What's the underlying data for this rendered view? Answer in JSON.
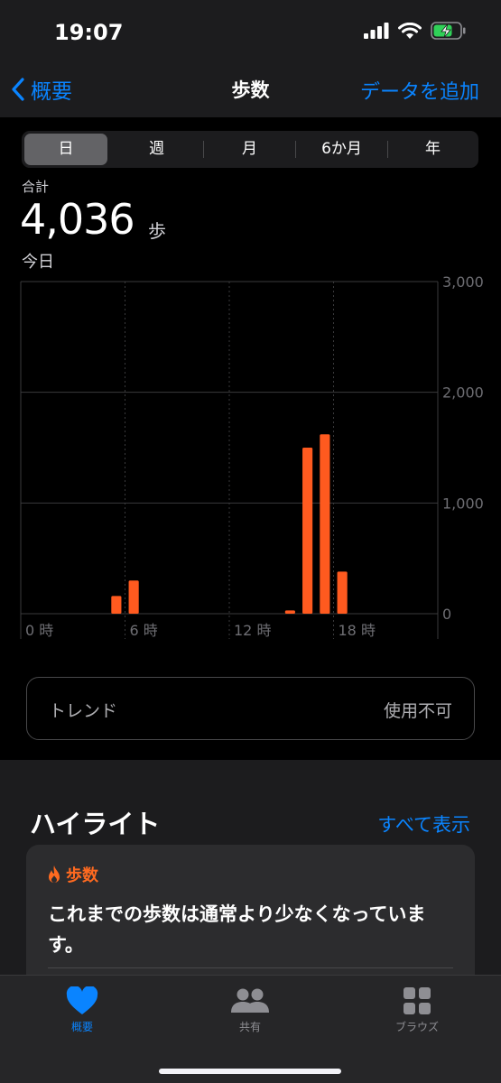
{
  "status_bar": {
    "time": "19:07"
  },
  "nav": {
    "back_label": "概要",
    "title": "歩数",
    "add_label": "データを追加"
  },
  "segments": [
    "日",
    "週",
    "月",
    "6か月",
    "年"
  ],
  "summary": {
    "label": "合計",
    "value": "4,036",
    "unit": "歩",
    "date": "今日"
  },
  "chart_data": {
    "type": "bar",
    "x_ticks": [
      "0 時",
      "6 時",
      "12 時",
      "18 時"
    ],
    "y_ticks": [
      "0",
      "1,000",
      "2,000",
      "3,000"
    ],
    "ylim": [
      0,
      3000
    ],
    "xlim": [
      0,
      24
    ],
    "grid": true,
    "color": "#ff5a1f",
    "values": [
      {
        "hour": 5,
        "value": 160
      },
      {
        "hour": 6,
        "value": 300
      },
      {
        "hour": 15,
        "value": 30
      },
      {
        "hour": 16,
        "value": 1500
      },
      {
        "hour": 17,
        "value": 1620
      },
      {
        "hour": 18,
        "value": 380
      }
    ]
  },
  "trend": {
    "label": "トレンド",
    "value": "使用不可"
  },
  "highlights": {
    "title": "ハイライト",
    "show_all": "すべて表示",
    "card": {
      "category": "歩数",
      "text": "これまでの歩数は通常より少なくなっています。"
    }
  },
  "tabs": [
    {
      "label": "概要",
      "icon": "heart-icon",
      "active": true
    },
    {
      "label": "共有",
      "icon": "people-icon",
      "active": false
    },
    {
      "label": "ブラウズ",
      "icon": "grid-icon",
      "active": false
    }
  ],
  "colors": {
    "accent": "#0a84ff",
    "steps": "#ff5a1f"
  }
}
